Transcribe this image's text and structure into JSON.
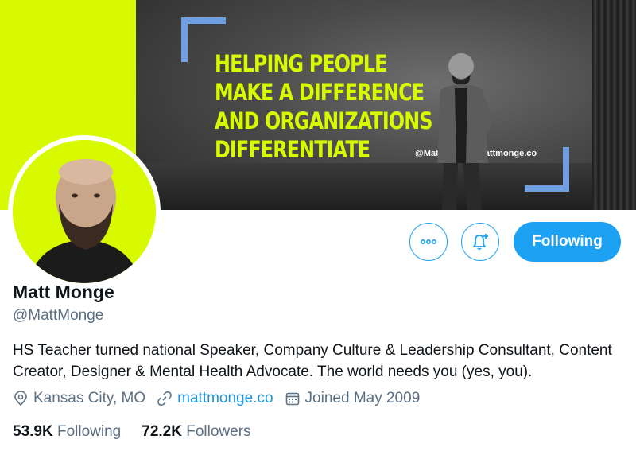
{
  "banner": {
    "headline": [
      "HELPING PEOPLE",
      "MAKE A DIFFERENCE",
      "AND ORGANIZATIONS",
      "DIFFERENTIATE"
    ],
    "tagline": "@MattMonge | mattmonge.co",
    "accent_color": "#d8fa00",
    "bracket_color": "#6f9fe0"
  },
  "profile": {
    "name": "Matt Monge",
    "handle": "@MattMonge",
    "bio": "HS Teacher turned national Speaker, Company Culture & Leadership Consultant, Content Creator, Designer & Mental Health Advocate. The world needs you (yes, you).",
    "location": "Kansas City, MO",
    "website": "mattmonge.co",
    "joined": "Joined May 2009"
  },
  "actions": {
    "more_icon": "more-dots-icon",
    "bell_icon": "notification-bell-plus-icon",
    "follow_label": "Following",
    "brand_color": "#1da1f2"
  },
  "stats": {
    "following_count": "53.9K",
    "following_label": "Following",
    "followers_count": "72.2K",
    "followers_label": "Followers"
  }
}
